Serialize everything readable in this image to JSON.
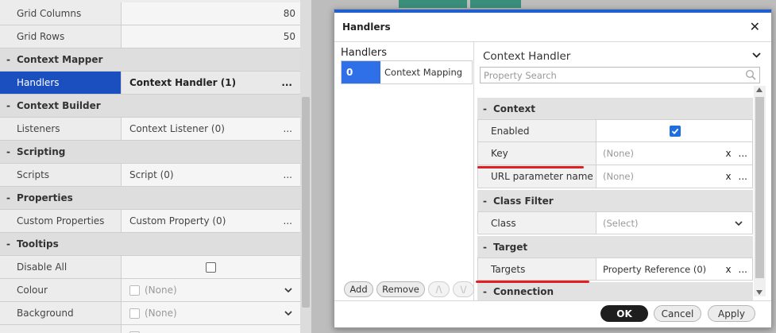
{
  "background_grid": {
    "rows": [
      {
        "type": "row",
        "key": "Grid Columns",
        "value": "80",
        "numeric": true
      },
      {
        "type": "row",
        "key": "Grid Rows",
        "value": "50",
        "numeric": true
      },
      {
        "type": "category",
        "label": "Context Mapper"
      },
      {
        "type": "row",
        "key": "Handlers",
        "value": "Context Handler (1)",
        "dots": "...",
        "selected": true
      },
      {
        "type": "category",
        "label": "Context Builder"
      },
      {
        "type": "row",
        "key": "Listeners",
        "value": "Context Listener (0)",
        "dots": "..."
      },
      {
        "type": "category",
        "label": "Scripting"
      },
      {
        "type": "row",
        "key": "Scripts",
        "value": "Script (0)",
        "dots": "..."
      },
      {
        "type": "category",
        "label": "Properties"
      },
      {
        "type": "row",
        "key": "Custom Properties",
        "value": "Custom Property (0)",
        "dots": "..."
      },
      {
        "type": "category",
        "label": "Tooltips"
      },
      {
        "type": "row",
        "key": "Disable All",
        "checkbox": true
      },
      {
        "type": "row",
        "key": "Colour",
        "value": "(None)",
        "dropdown": true
      },
      {
        "type": "row",
        "key": "Background",
        "value": "(None)",
        "dropdown": true
      }
    ]
  },
  "dialog": {
    "title": "Handlers",
    "close_glyph": "✕",
    "left_pane": {
      "heading": "Handlers",
      "items": [
        {
          "index": "0",
          "label": "Context Mapping"
        }
      ],
      "buttons": {
        "add": "Add",
        "remove": "Remove",
        "up": "/\\",
        "down": "\\/"
      }
    },
    "right_pane": {
      "heading": "Context Handler",
      "search_placeholder": "Property Search",
      "categories": {
        "context": "Context",
        "class_filter": "Class Filter",
        "target": "Target",
        "connection": "Connection"
      },
      "props": {
        "enabled": {
          "key": "Enabled",
          "checked": true
        },
        "key": {
          "key": "Key",
          "value": "(None)",
          "clear": "x",
          "dots": "..."
        },
        "url_param": {
          "key": "URL parameter name",
          "value": "(None)",
          "clear": "x",
          "dots": "..."
        },
        "class": {
          "key": "Class",
          "value": "(Select)"
        },
        "targets": {
          "key": "Targets",
          "value": "Property Reference (0)",
          "clear": "x",
          "dots": "..."
        }
      }
    },
    "footer": {
      "ok": "OK",
      "cancel": "Cancel",
      "apply": "Apply"
    }
  },
  "colors": {
    "accent": "#1f5fd0",
    "selected": "#1b4fbf",
    "checkbox": "#1f6ee0",
    "highlight": "#e02020"
  },
  "icons": [
    "close-icon",
    "chevron-down-icon",
    "search-icon",
    "checkbox-icon",
    "scroll-up-icon",
    "scroll-down-icon"
  ]
}
